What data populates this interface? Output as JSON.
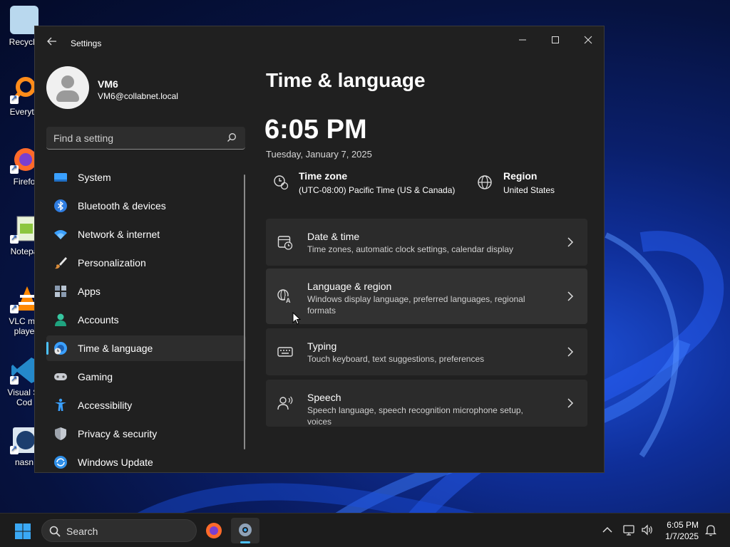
{
  "desktop": {
    "icons": [
      {
        "label": "Recycle"
      },
      {
        "label": "Everyth"
      },
      {
        "label": "Firefo"
      },
      {
        "label": "Notepa"
      },
      {
        "label": "VLC me playe"
      },
      {
        "label": "Visual St Cod"
      },
      {
        "label": "nasn"
      }
    ]
  },
  "window": {
    "title": "Settings",
    "back_icon": "arrow-left-icon",
    "controls": [
      "minimize",
      "maximize",
      "close"
    ]
  },
  "profile": {
    "name": "VM6",
    "email": "VM6@collabnet.local"
  },
  "search": {
    "placeholder": "Find a setting"
  },
  "nav": {
    "items": [
      {
        "label": "System",
        "icon": "display-icon"
      },
      {
        "label": "Bluetooth & devices",
        "icon": "bluetooth-icon"
      },
      {
        "label": "Network & internet",
        "icon": "wifi-icon"
      },
      {
        "label": "Personalization",
        "icon": "brush-icon"
      },
      {
        "label": "Apps",
        "icon": "apps-icon"
      },
      {
        "label": "Accounts",
        "icon": "person-icon"
      },
      {
        "label": "Time & language",
        "icon": "globe-clock-icon"
      },
      {
        "label": "Gaming",
        "icon": "gamepad-icon"
      },
      {
        "label": "Accessibility",
        "icon": "accessibility-icon"
      },
      {
        "label": "Privacy & security",
        "icon": "shield-icon"
      },
      {
        "label": "Windows Update",
        "icon": "update-icon"
      }
    ],
    "active": "Time & language"
  },
  "main": {
    "title": "Time & language",
    "time": "6:05 PM",
    "date": "Tuesday, January 7, 2025",
    "timezone_label": "Time zone",
    "timezone_value": "(UTC-08:00) Pacific Time (US & Canada)",
    "region_label": "Region",
    "region_value": "United States",
    "cards": [
      {
        "title": "Date & time",
        "desc": "Time zones, automatic clock settings, calendar display",
        "icon": "calendar-clock-icon"
      },
      {
        "title": "Language & region",
        "desc": "Windows display language, preferred languages, regional formats",
        "icon": "language-icon"
      },
      {
        "title": "Typing",
        "desc": "Touch keyboard, text suggestions, preferences",
        "icon": "keyboard-icon"
      },
      {
        "title": "Speech",
        "desc": "Speech language, speech recognition microphone setup, voices",
        "icon": "speech-icon"
      }
    ]
  },
  "taskbar": {
    "search_label": "Search",
    "time": "6:05 PM",
    "date": "1/7/2025"
  },
  "colors": {
    "accent": "#4cc2ff",
    "window_bg": "#202020",
    "card_bg": "#2b2b2b"
  }
}
